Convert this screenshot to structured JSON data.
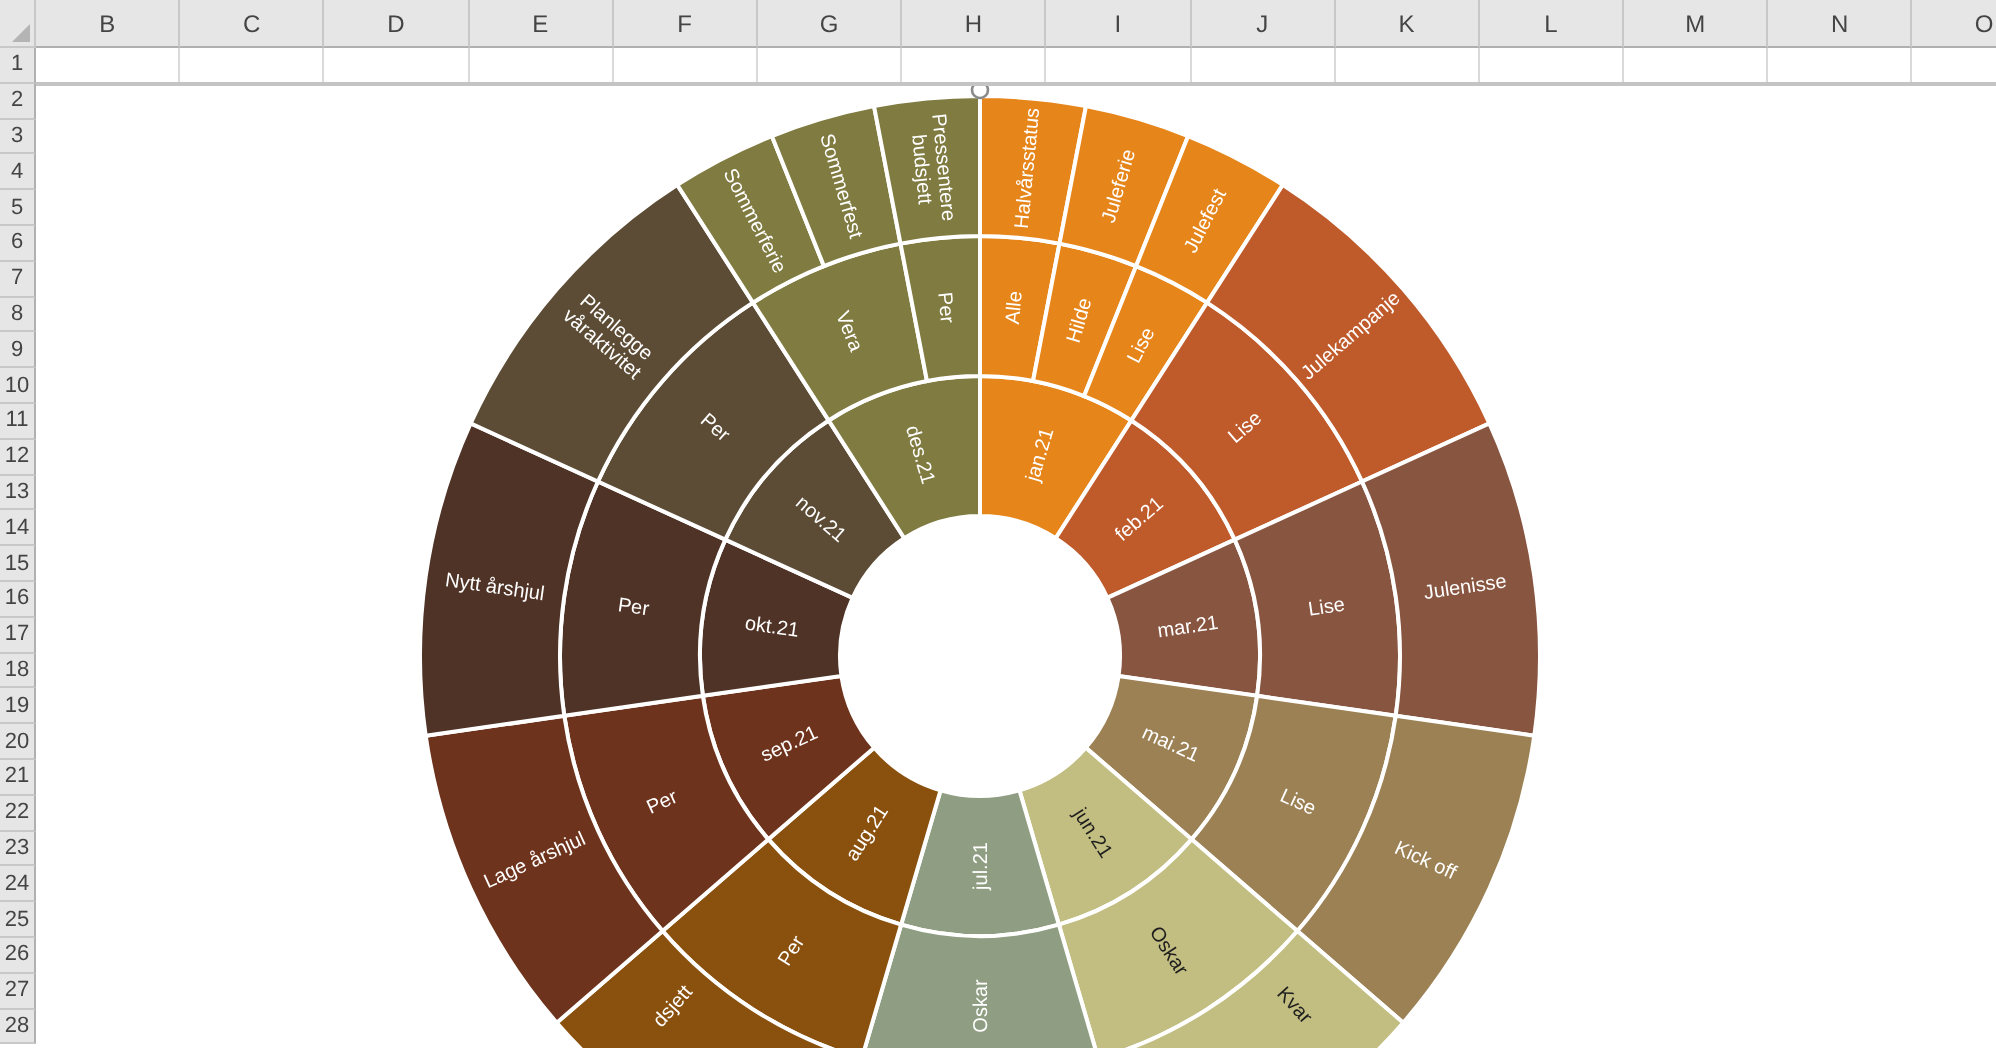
{
  "sheet": {
    "columns": [
      "B",
      "C",
      "D",
      "E",
      "F",
      "G",
      "H",
      "I",
      "J",
      "K",
      "L",
      "M",
      "N",
      "O"
    ],
    "rows": [
      "1",
      "2",
      "3",
      "4",
      "5",
      "6",
      "7",
      "8",
      "9",
      "10",
      "11",
      "12",
      "13",
      "14",
      "15",
      "16",
      "17",
      "18",
      "19",
      "20",
      "21",
      "22",
      "23",
      "24",
      "25",
      "26",
      "27",
      "28"
    ]
  },
  "sunburst": {
    "segments": [
      {
        "label": "jan.21",
        "color": "#e6851a",
        "children": [
          {
            "label": "Alle",
            "children": [
              {
                "label": "Halvårsstatus"
              }
            ]
          },
          {
            "label": "Hilde",
            "children": [
              {
                "label": "Juleferie"
              }
            ]
          },
          {
            "label": "Lise",
            "children": [
              {
                "label": "Julefest"
              }
            ]
          }
        ]
      },
      {
        "label": "feb.21",
        "color": "#bf5a2b",
        "children": [
          {
            "label": "Lise",
            "children": [
              {
                "label": "Julekampanje"
              }
            ]
          }
        ]
      },
      {
        "label": "mar.21",
        "color": "#875540",
        "children": [
          {
            "label": "Lise",
            "children": [
              {
                "label": "Julenisse"
              }
            ]
          }
        ]
      },
      {
        "label": "mai.21",
        "color": "#9c8155",
        "children": [
          {
            "label": "Lise",
            "children": [
              {
                "label": "Kick off"
              }
            ]
          }
        ]
      },
      {
        "label": "jun.21",
        "color": "#c2bd80",
        "children": [
          {
            "label": "Oskar",
            "children": [
              {
                "label": "Kvar"
              }
            ]
          }
        ]
      },
      {
        "label": "jul.21",
        "color": "#8f9e82",
        "children": [
          {
            "label": "Oskar"
          }
        ]
      },
      {
        "label": "aug.21",
        "color": "#8a500e",
        "children": [
          {
            "label": "Per",
            "children": [
              {
                "label": "dsjett"
              }
            ]
          }
        ]
      },
      {
        "label": "sep.21",
        "color": "#6e331c",
        "children": [
          {
            "label": "Per",
            "children": [
              {
                "label": "Lage årshjul"
              }
            ]
          }
        ]
      },
      {
        "label": "okt.21",
        "color": "#4f3326",
        "children": [
          {
            "label": "Per",
            "children": [
              {
                "label": "Nytt årshjul"
              }
            ]
          }
        ]
      },
      {
        "label": "nov.21",
        "color": "#5c4c35",
        "children": [
          {
            "label": "Per",
            "children": [
              {
                "label": "Planlegge våraktivitet"
              }
            ]
          }
        ]
      },
      {
        "label": "des.21",
        "color": "#807b40",
        "children": [
          {
            "label": "Vera",
            "children": [
              {
                "label": "Sommerferie"
              },
              {
                "label": "Sommerfest"
              }
            ]
          },
          {
            "label": "Per",
            "children": [
              {
                "label": "Pressentere budsjett"
              }
            ]
          }
        ]
      }
    ]
  }
}
